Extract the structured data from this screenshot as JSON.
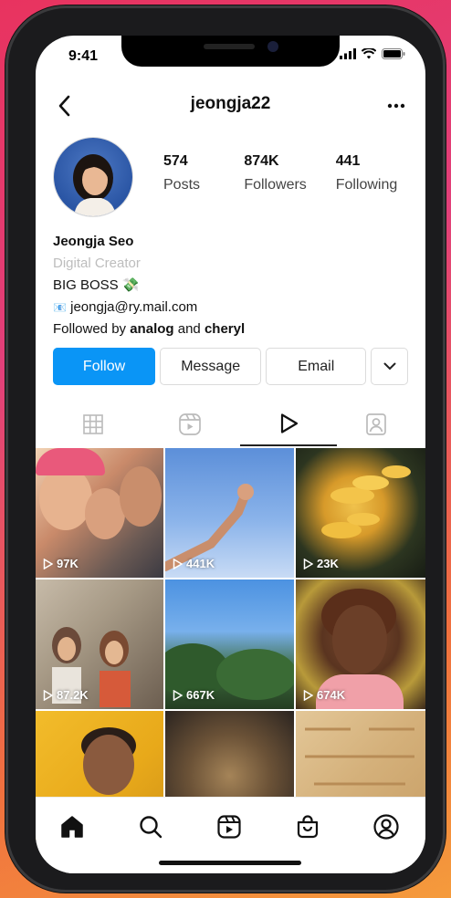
{
  "status_bar": {
    "time": "9:41"
  },
  "profile": {
    "username": "jeongja22",
    "stats": [
      {
        "value": "574",
        "label": "Posts"
      },
      {
        "value": "874K",
        "label": "Followers"
      },
      {
        "value": "441",
        "label": "Following"
      }
    ],
    "name": "Jeongja Seo",
    "category": "Digital Creator",
    "bio_line": "BIG BOSS",
    "bio_emoji": "💸",
    "email_emoji": "📧",
    "email": "jeongja@ry.mail.com",
    "followed_by_prefix": "Followed by",
    "followed_by_user1": "analog",
    "followed_by_and": "and",
    "followed_by_user2": "cheryl"
  },
  "actions": {
    "follow": "Follow",
    "message": "Message",
    "email": "Email"
  },
  "tabs": [
    "grid-icon",
    "reels-icon",
    "play-icon",
    "tagged-icon"
  ],
  "active_tab": "play-icon",
  "grid": [
    {
      "views": "97K"
    },
    {
      "views": "441K"
    },
    {
      "views": "23K"
    },
    {
      "views": "87.2K"
    },
    {
      "views": "667K"
    },
    {
      "views": "674K"
    },
    {
      "views": ""
    },
    {
      "views": ""
    },
    {
      "views": ""
    }
  ],
  "bottom_nav": [
    "home-icon",
    "search-icon",
    "reels-icon",
    "shop-icon",
    "profile-icon"
  ],
  "colors": {
    "follow_button": "#0a95f6",
    "text": "#111111",
    "category": "#bdbdbd"
  }
}
